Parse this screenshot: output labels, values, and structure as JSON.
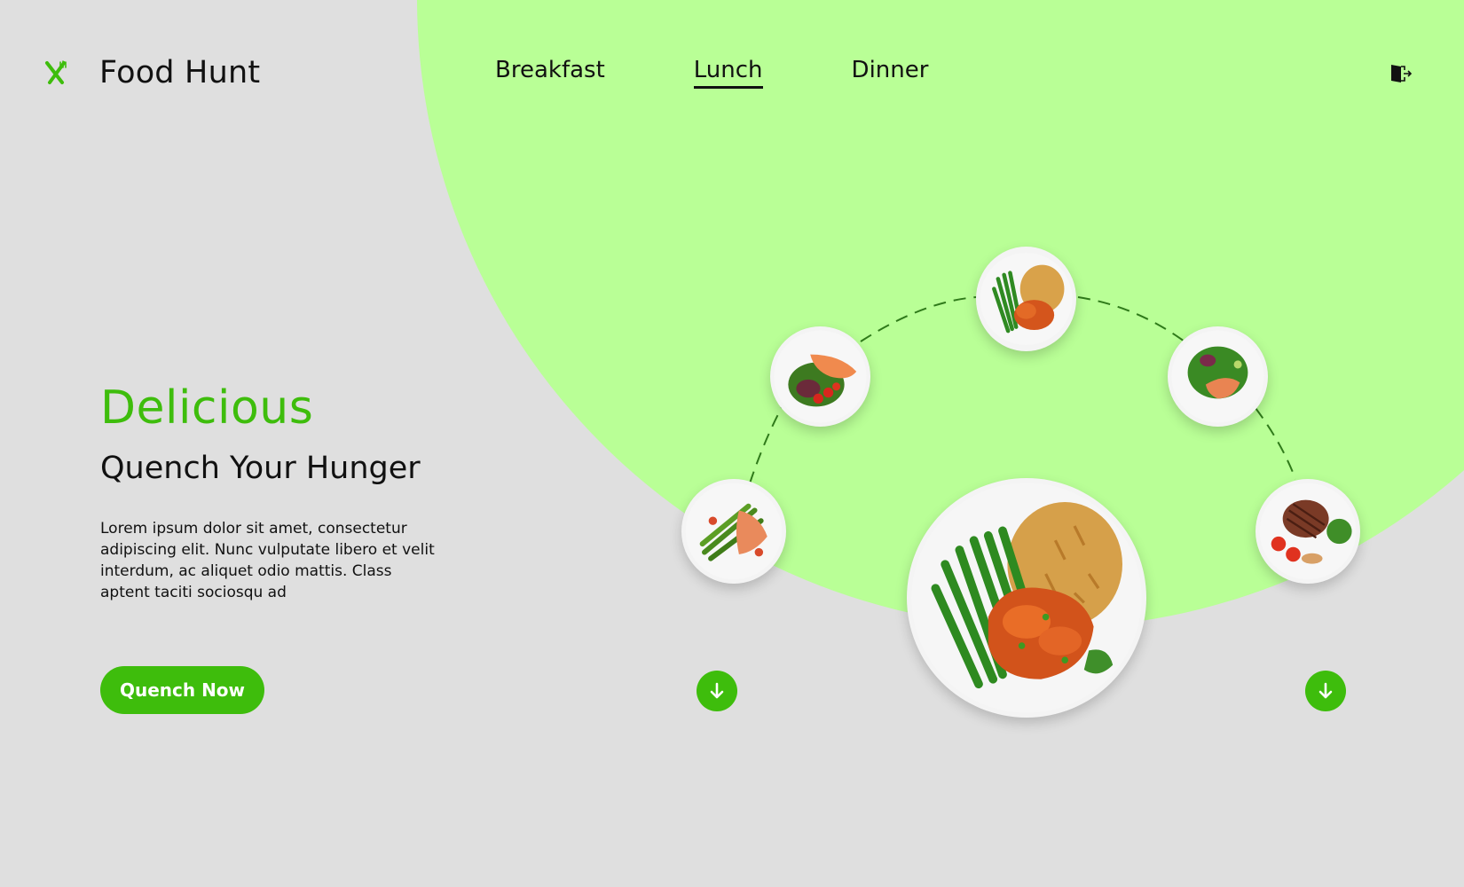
{
  "brand": {
    "name": "Food Hunt",
    "icon": "fork-knife-icon"
  },
  "nav": {
    "items": [
      {
        "label": "Breakfast",
        "active": false
      },
      {
        "label": "Lunch",
        "active": true
      },
      {
        "label": "Dinner",
        "active": false
      }
    ],
    "logout_icon": "logout-icon"
  },
  "hero": {
    "title": "Delicious",
    "subtitle": "Quench Your Hunger",
    "description": "Lorem ipsum dolor sit amet, consectetur adipiscing elit. Nunc vulputate libero et velit interdum, ac aliquet odio mattis. Class aptent taciti sociosqu ad",
    "cta_label": "Quench Now"
  },
  "carousel": {
    "dishes": [
      "asparagus-salmon-dish",
      "salmon-salad-dish",
      "chicken-rice-beans-dish",
      "salmon-greens-salad-dish",
      "steak-broccoli-dish"
    ],
    "featured_dish": "chicken-rice-beans-dish",
    "prev_icon": "arrow-down-icon",
    "next_icon": "arrow-down-icon"
  },
  "colors": {
    "accent": "#3ebd0c",
    "background": "#dfdfdf",
    "blob": "#b9ff96",
    "text": "#111111"
  }
}
